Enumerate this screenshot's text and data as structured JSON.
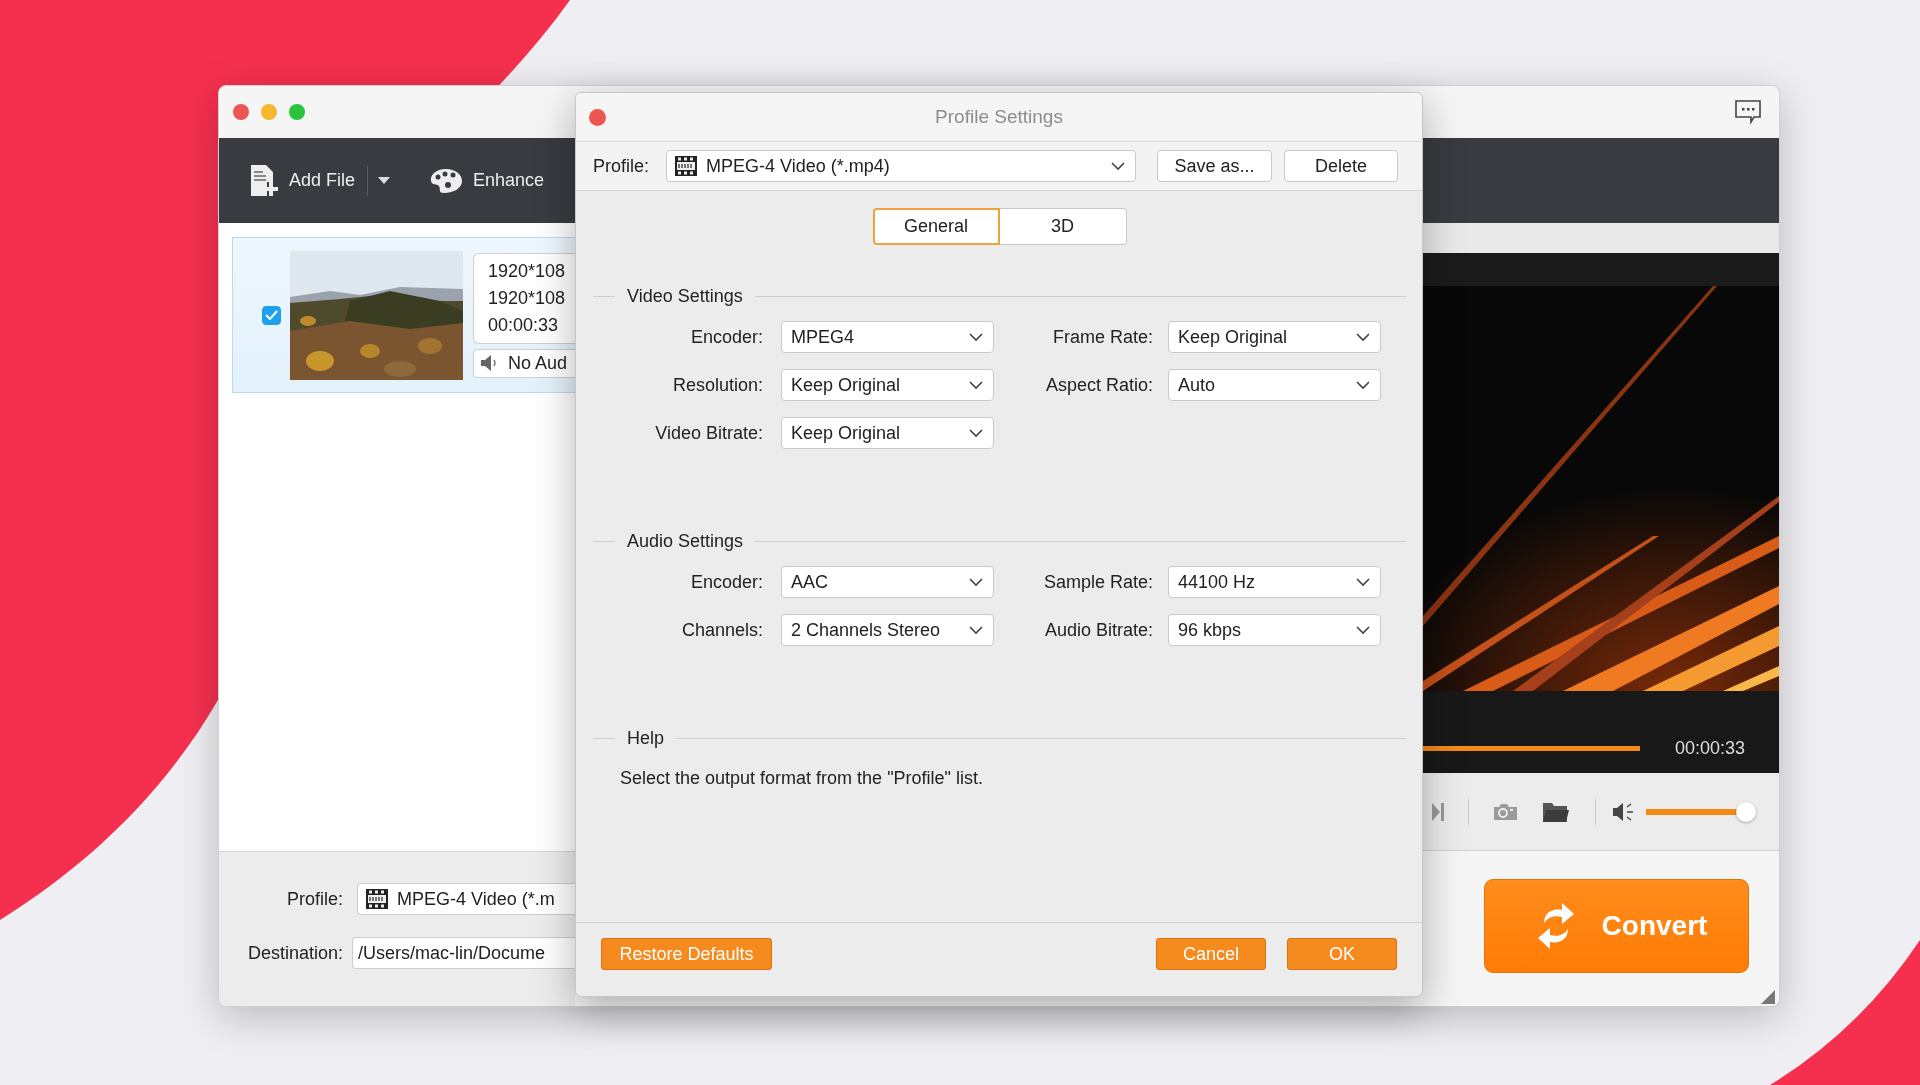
{
  "main_window": {
    "toolbar": {
      "add_file": "Add File",
      "enhance": "Enhance"
    },
    "files": [
      {
        "checked": true,
        "selected": true,
        "info": [
          "1920*108",
          "1920*108",
          "00:00:33"
        ],
        "audio": "No Aud"
      }
    ],
    "player": {
      "progress": {
        "level": 1
      },
      "time": "00:00:33",
      "volume": {
        "level": 1
      }
    },
    "profile": {
      "label": "Profile:",
      "value": "MPEG-4 Video (*.m"
    },
    "destination": {
      "label": "Destination:",
      "value": "/Users/mac-lin/Docume"
    },
    "convert_button": "Convert"
  },
  "dialog": {
    "title": "Profile Settings",
    "profile_label": "Profile:",
    "profile_value": "MPEG-4 Video (*.mp4)",
    "buttons": [
      "Save as...",
      "Delete"
    ],
    "tabs": [
      {
        "label": "General",
        "selected": true
      },
      {
        "label": "3D",
        "selected": false
      }
    ],
    "sections": [
      {
        "title": "Video Settings",
        "rows": [
          [
            {
              "label": "Encoder:",
              "value": "MPEG4"
            },
            {
              "label": "Frame Rate:",
              "value": "Keep Original"
            }
          ],
          [
            {
              "label": "Resolution:",
              "value": "Keep Original"
            },
            {
              "label": "Aspect Ratio:",
              "value": "Auto"
            }
          ],
          [
            {
              "label": "Video Bitrate:",
              "value": "Keep Original"
            }
          ]
        ]
      },
      {
        "title": "Audio Settings",
        "rows": [
          [
            {
              "label": "Encoder:",
              "value": "AAC"
            },
            {
              "label": "Sample Rate:",
              "value": "44100 Hz"
            }
          ],
          [
            {
              "label": "Channels:",
              "value": "2 Channels Stereo"
            },
            {
              "label": "Audio Bitrate:",
              "value": "96 kbps"
            }
          ]
        ]
      },
      {
        "title": "Help",
        "text": "Select the output format from the \"Profile\" list."
      }
    ],
    "restore_button": "Restore Defaults",
    "actions": [
      "Cancel",
      "OK"
    ]
  }
}
